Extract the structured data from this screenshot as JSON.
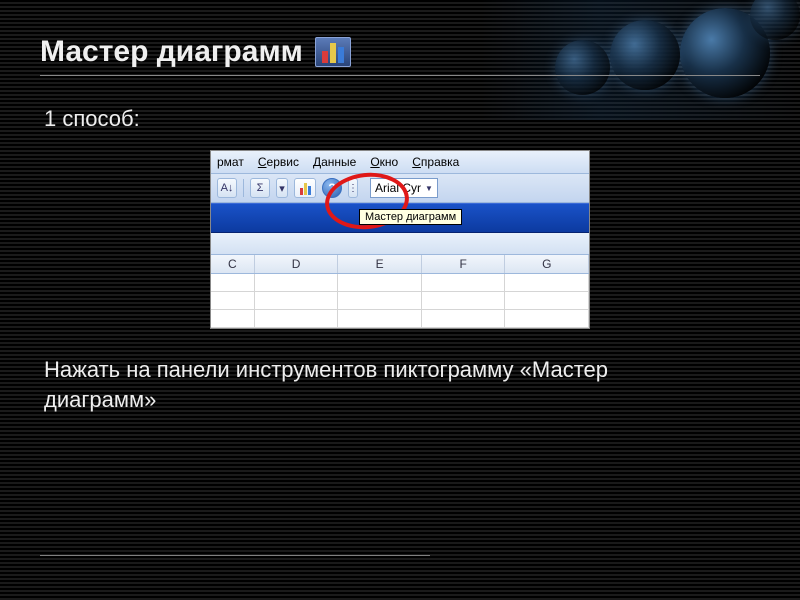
{
  "title": "Мастер диаграмм",
  "subtitle": "1 способ:",
  "body": "Нажать на панели инструментов пиктограмму «Мастер диаграмм»",
  "screenshot": {
    "menu": {
      "format": "рмат",
      "service": "Сервис",
      "data": "Данные",
      "window": "Окно",
      "help": "Справка"
    },
    "toolbar": {
      "sort_label": "А↓",
      "sigma": "Σ",
      "dropdown_glyph": "▾",
      "help_glyph": "?",
      "handle_glyph": "⋮"
    },
    "font": {
      "name": "Arial Cyr"
    },
    "tooltip": "Мастер диаграмм",
    "columns": [
      "C",
      "D",
      "E",
      "F",
      "G"
    ]
  }
}
